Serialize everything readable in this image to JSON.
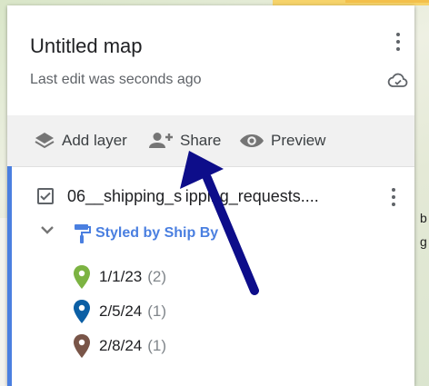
{
  "map": {
    "title": "Untitled map",
    "last_edit": "Last edit was seconds ago"
  },
  "toolbar": {
    "add_layer": "Add layer",
    "share": "Share",
    "preview": "Preview"
  },
  "layer": {
    "name": "06__shipping_s ipping_requests....",
    "style_label": "Styled by Ship By",
    "accent_color": "#4a7fe0",
    "legend": [
      {
        "label": "1/1/23",
        "count": "(2)",
        "color": "#7cb342"
      },
      {
        "label": "2/5/24",
        "count": "(1)",
        "color": "#0b5fa5"
      },
      {
        "label": "2/8/24",
        "count": "(1)",
        "color": "#795548"
      }
    ]
  },
  "annotation": {
    "arrow_color": "#0d0d8a"
  }
}
